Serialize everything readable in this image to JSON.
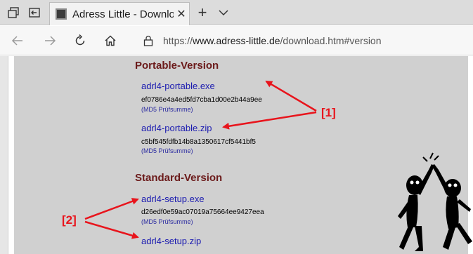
{
  "tab": {
    "title": "Adress Little - Download",
    "close": "✕"
  },
  "tabbar": {
    "new_tab": "+"
  },
  "address": {
    "protocol": "https://",
    "host": "www.adress-little.de",
    "path": "/download.htm#version"
  },
  "sections": [
    {
      "heading": "Portable-Version",
      "files": [
        {
          "name": "adrl4-portable.exe",
          "md5": "ef0786e4a4ed5fd7cba1d00e2b44a9ee",
          "note": "(MD5 Prüfsumme)"
        },
        {
          "name": "adrl4-portable.zip",
          "md5": "c5bf545fdfb14b8a1350617cf5441bf5",
          "note": "(MD5 Prüfsumme)"
        }
      ]
    },
    {
      "heading": "Standard-Version",
      "files": [
        {
          "name": "adrl4-setup.exe",
          "md5": "d26edf0e59ac07019a75664ee9427eea",
          "note": "(MD5 Prüfsumme)"
        },
        {
          "name": "adrl4-setup.zip"
        }
      ]
    }
  ],
  "annotations": {
    "label1": "[1]",
    "label2": "[2]"
  },
  "colors": {
    "annotation": "#e8141c",
    "heading": "#6b1a1a",
    "link": "#1b1bb0",
    "page_bg": "#d0d0d0"
  }
}
